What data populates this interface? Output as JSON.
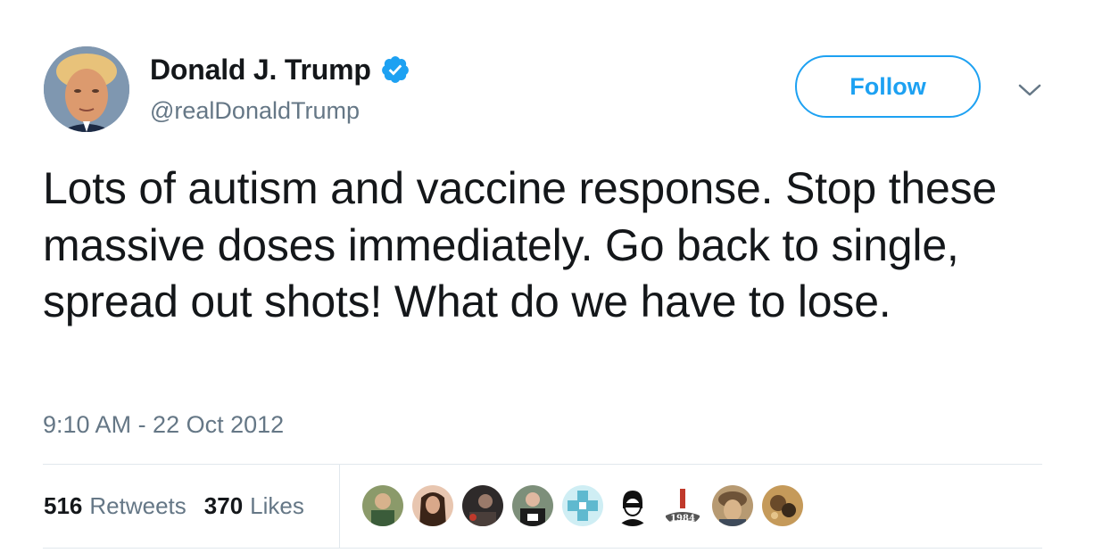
{
  "user": {
    "display_name": "Donald J. Trump",
    "handle": "@realDonaldTrump",
    "verified": true,
    "avatar_icon": "profile-photo"
  },
  "actions": {
    "follow_label": "Follow",
    "menu_icon": "chevron-down-icon"
  },
  "tweet": {
    "text": "Lots of autism and vaccine response. Stop these massive doses immediately. Go back to single, spread out shots! What do we have to lose.",
    "timestamp": "9:10 AM - 22 Oct 2012"
  },
  "stats": {
    "retweets_count": "516",
    "retweets_label": "Retweets",
    "likes_count": "370",
    "likes_label": "Likes"
  },
  "likers": [
    {
      "name": "liker-avatar-1",
      "color": "#6b7b5a"
    },
    {
      "name": "liker-avatar-2",
      "color": "#a7684a"
    },
    {
      "name": "liker-avatar-3",
      "color": "#3c3c3c"
    },
    {
      "name": "liker-avatar-4",
      "color": "#5d5d5d"
    },
    {
      "name": "liker-avatar-5",
      "color": "#7cc7d6"
    },
    {
      "name": "liker-avatar-6",
      "color": "#ffffff"
    },
    {
      "name": "liker-avatar-7",
      "color": "#ffffff",
      "label": "1984"
    },
    {
      "name": "liker-avatar-8",
      "color": "#8a6d4a"
    },
    {
      "name": "liker-avatar-9",
      "color": "#a06e38"
    }
  ],
  "colors": {
    "accent": "#1da1f2",
    "text_primary": "#14171a",
    "text_secondary": "#657786",
    "divider": "#e1e8ed"
  }
}
